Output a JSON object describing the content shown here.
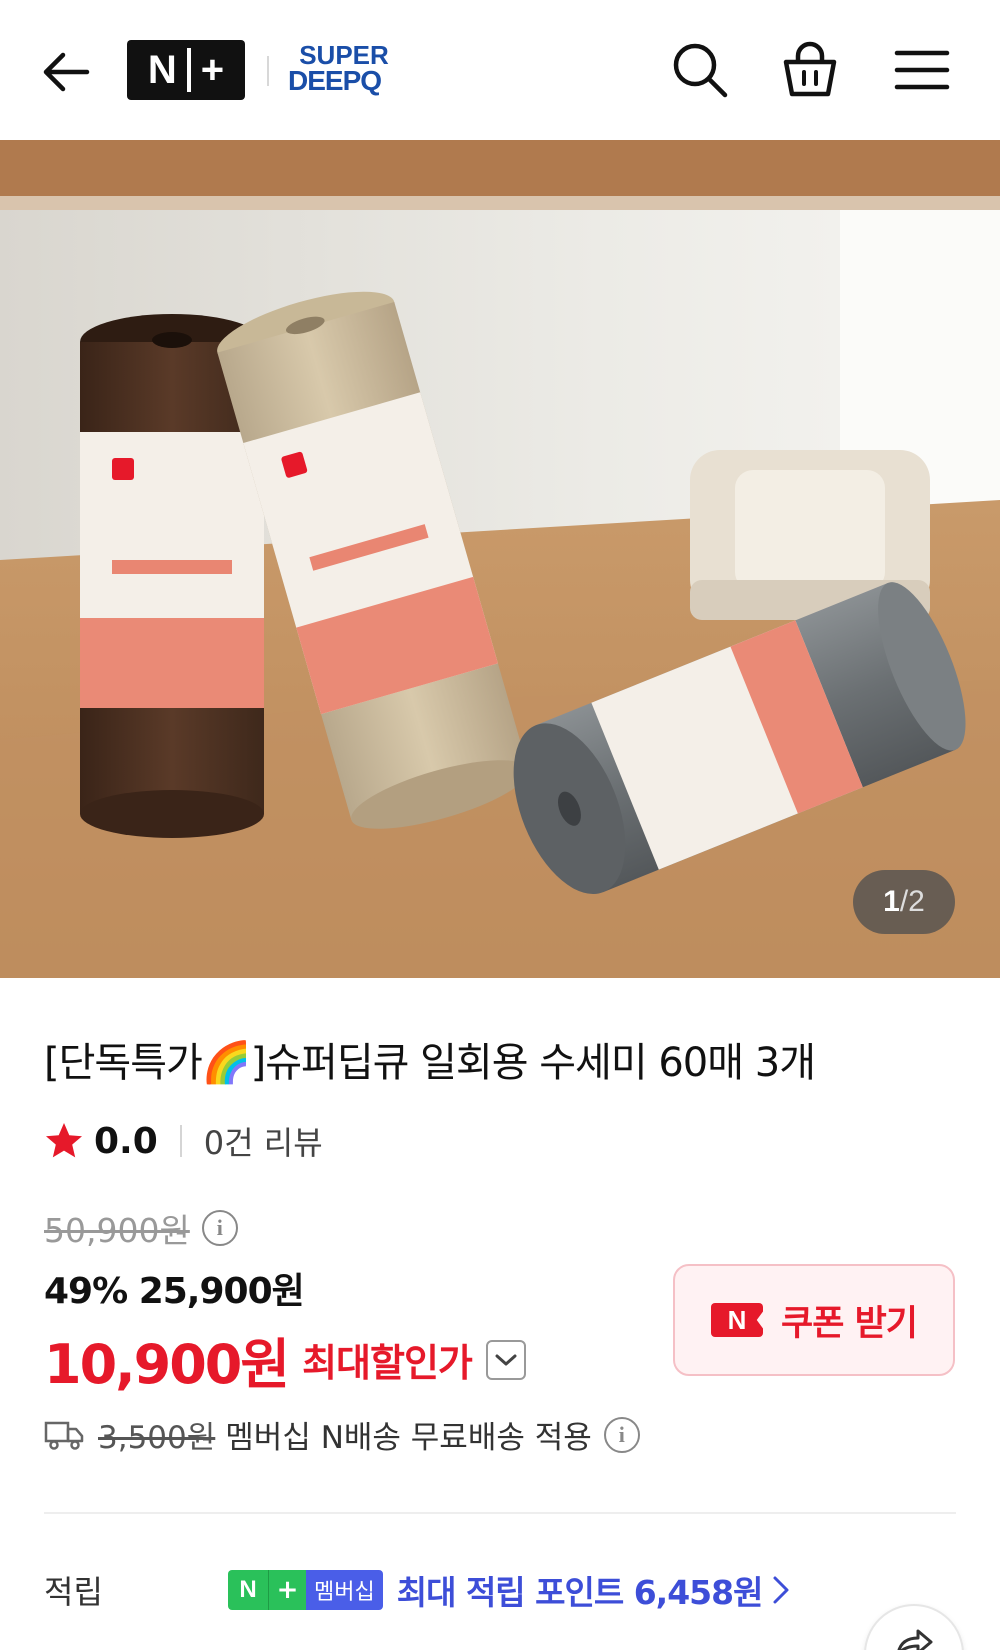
{
  "header": {
    "logo_n": "N",
    "logo_plus": "+",
    "brand_line1": "SUPER",
    "brand_line2": "DEEPQ"
  },
  "gallery": {
    "current": "1",
    "separator": "/",
    "total": "2"
  },
  "product": {
    "title": "[단독특가🌈]슈퍼딥큐 일회용 수세미 60매 3개",
    "rating": "0.0",
    "review_count": "0건 리뷰",
    "original_price": "50,900원",
    "discount_line": "49% 25,900원",
    "final_price": "10,900원",
    "final_price_label": "최대할인가"
  },
  "coupon": {
    "badge": "N",
    "label": "쿠폰 받기"
  },
  "shipping": {
    "original_fee": "3,500원",
    "text": "멤버십 N배송 무료배송 적용"
  },
  "points": {
    "label": "적립",
    "badge_n": "N",
    "badge_plus": "+",
    "badge_membership": "멤버십",
    "text": "최대 적립 포인트 6,458원"
  },
  "colors": {
    "accent_red": "#e6192a",
    "brand_blue": "#1a4ea8",
    "membership_green": "#2ac15a",
    "membership_blue": "#4a5ee8"
  },
  "icons": [
    "back-arrow-icon",
    "search-icon",
    "shopping-bag-icon",
    "menu-icon",
    "star-icon",
    "info-icon",
    "chevron-down-icon",
    "truck-icon",
    "chevron-right-icon",
    "share-icon"
  ]
}
